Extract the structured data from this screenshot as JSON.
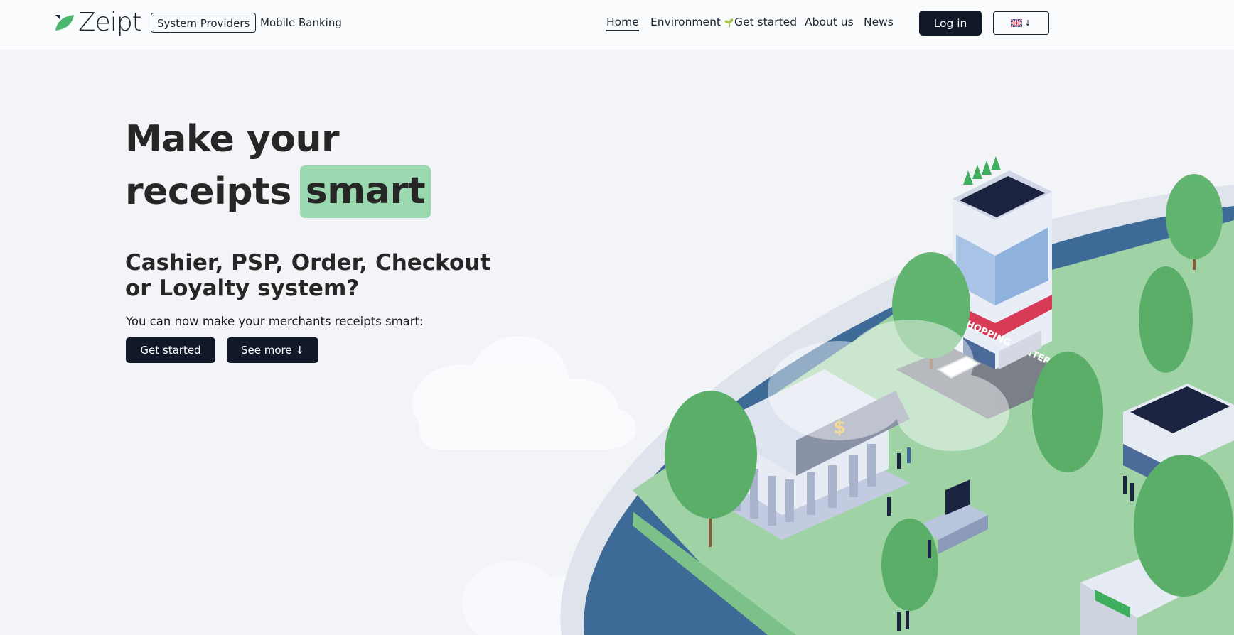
{
  "brand": {
    "name": "Zeipt"
  },
  "topnav": {
    "left_tabs": [
      {
        "label": "System Providers",
        "active": true
      },
      {
        "label": "Mobile Banking",
        "active": false
      }
    ],
    "links": [
      {
        "label": "Home",
        "current": true
      },
      {
        "label": "Environment",
        "current": false
      },
      {
        "label": "Get started",
        "current": false
      },
      {
        "label": "About us",
        "current": false
      },
      {
        "label": "News",
        "current": false
      }
    ],
    "environment_icon": "sprout-icon",
    "login_label": "Log in",
    "language": {
      "flag": "uk-flag-icon",
      "arrow": "↓"
    }
  },
  "hero": {
    "headline_line1": "Make your",
    "headline_line2_prefix": "receipts",
    "headline_highlight": "smart",
    "subheadline": "Cashier, PSP, Order, Checkout or Loyalty system?",
    "lead": "You can now make your merchants receipts smart:",
    "cta_primary": "Get started",
    "cta_secondary": "See more ↓",
    "illustration_sign_text": "SHOPPING CENTER"
  },
  "colors": {
    "dark": "#111827",
    "accent_green": "#9ad8b0",
    "background": "#f2f4f8"
  }
}
